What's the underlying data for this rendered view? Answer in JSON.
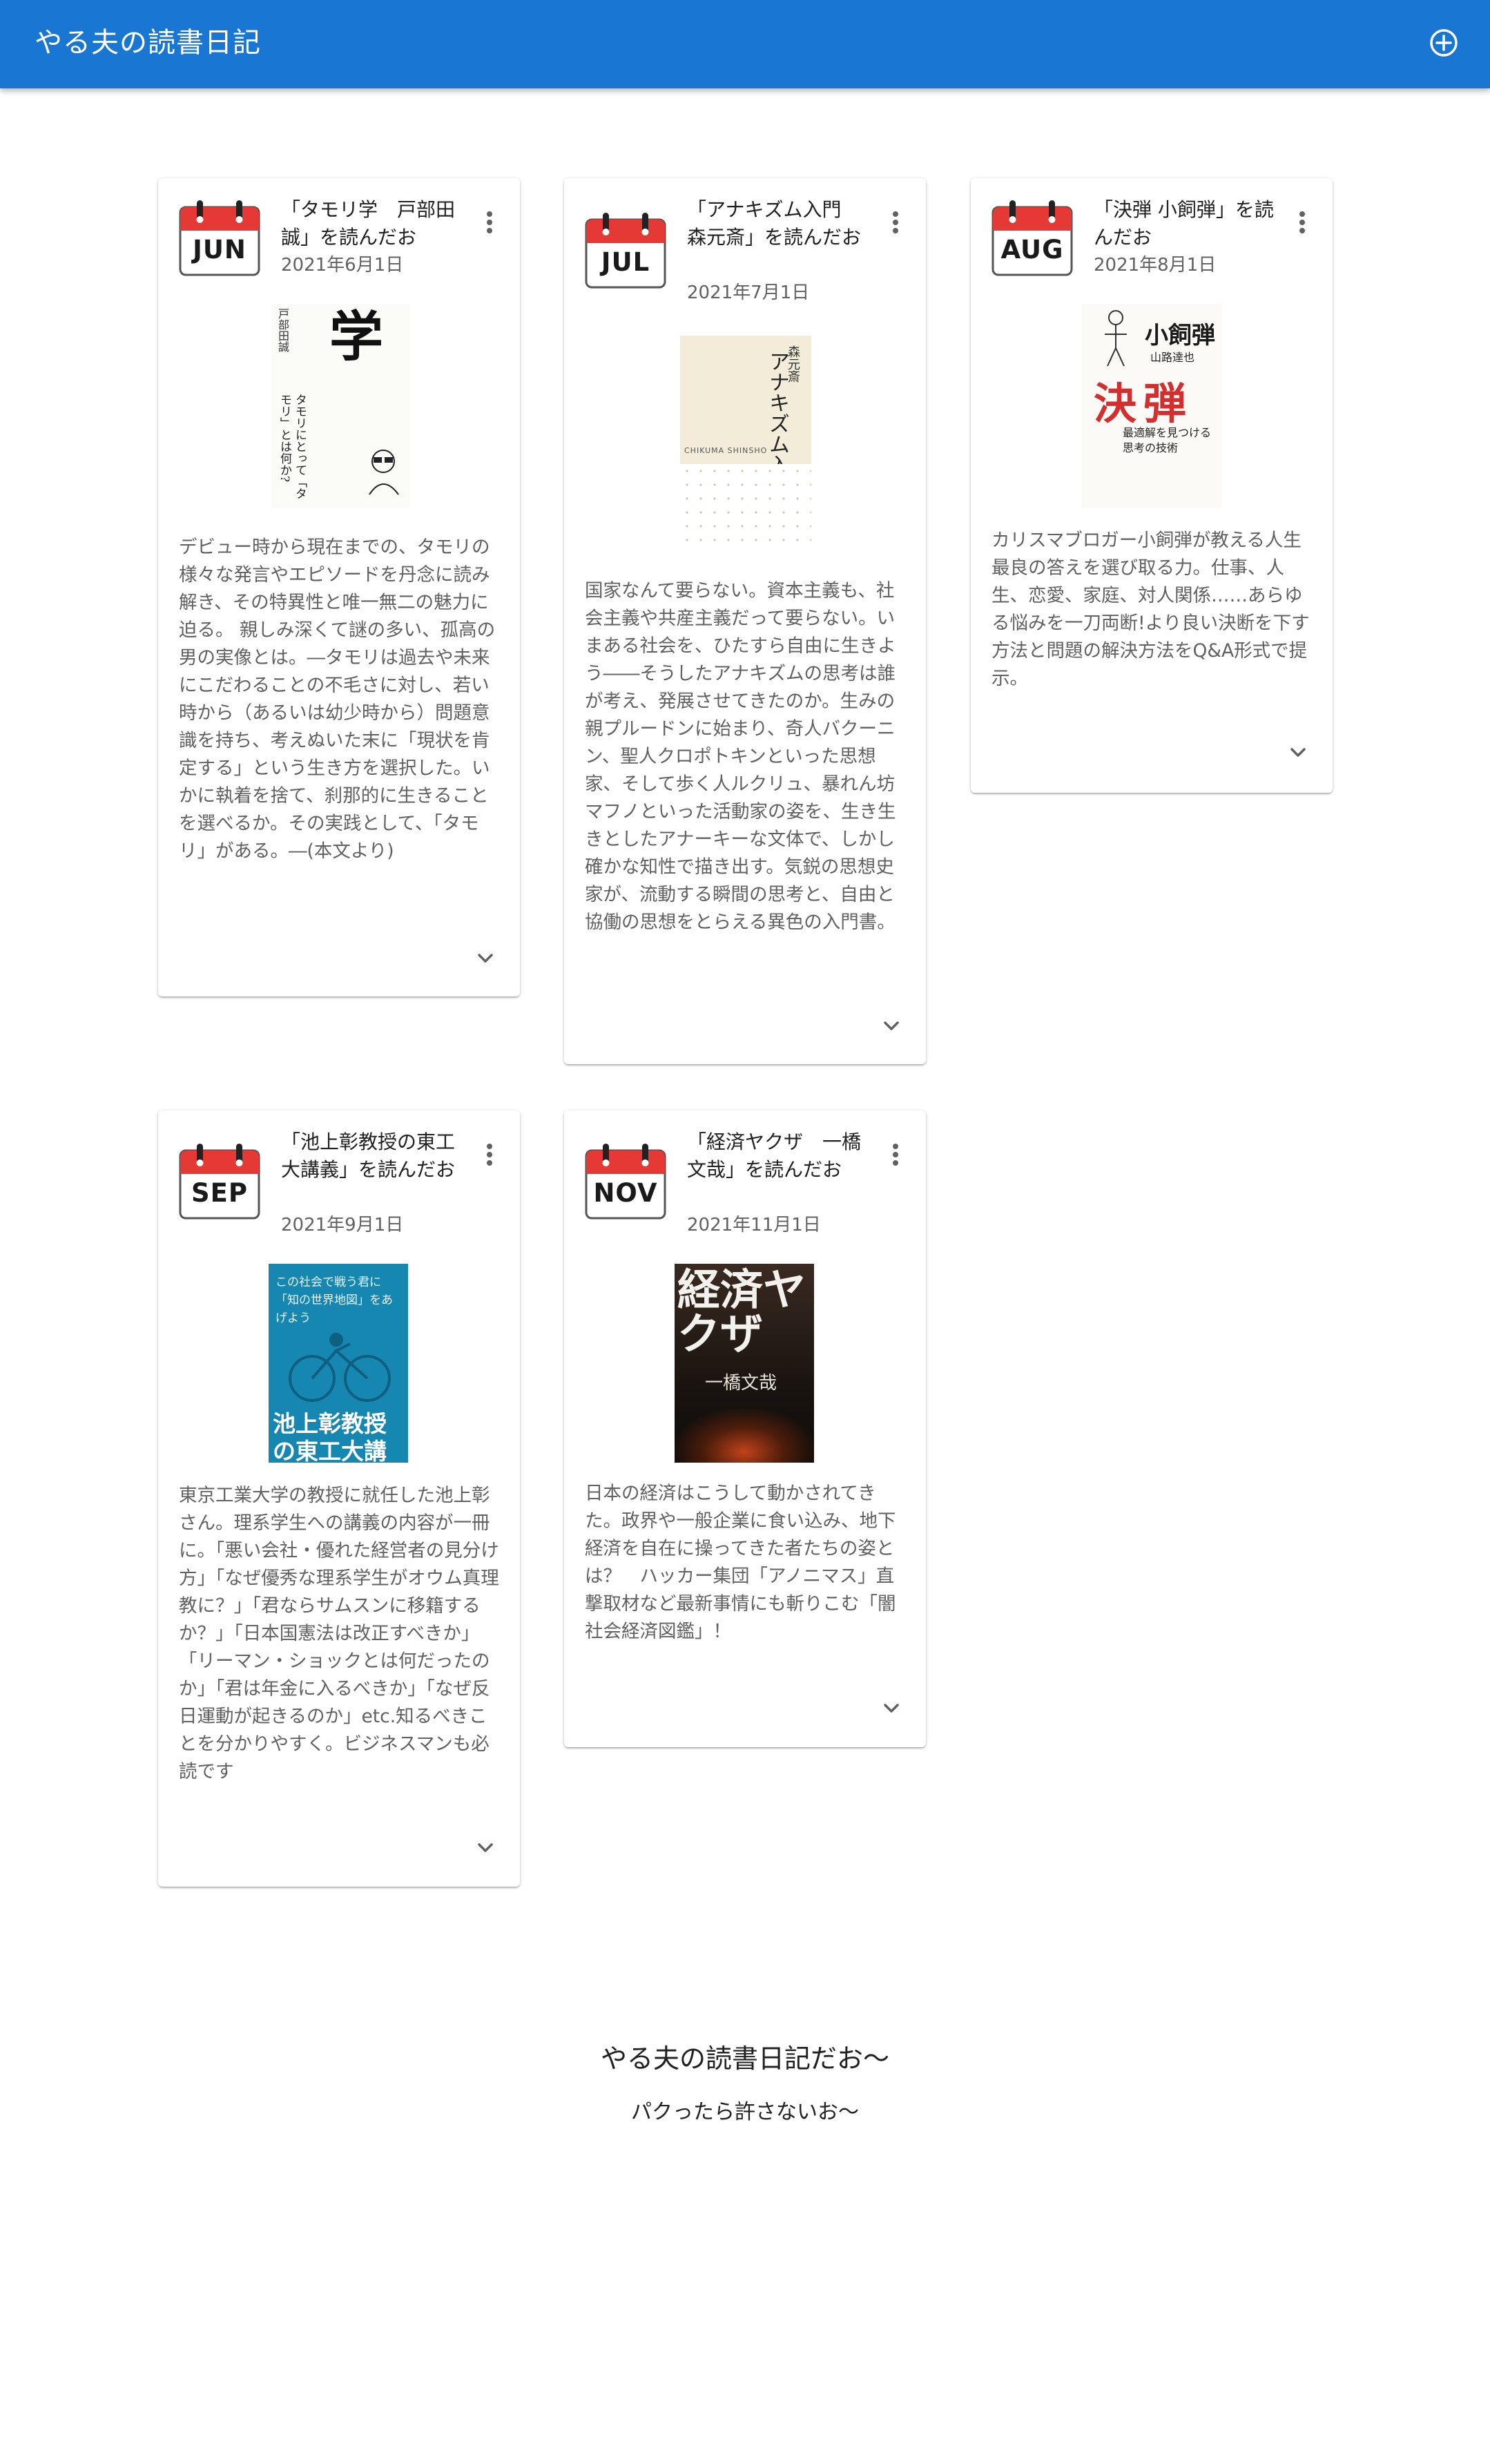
{
  "app": {
    "title": "やる夫の読書日記",
    "add_icon": "add-circle-outline-icon"
  },
  "cards": [
    {
      "month": "JUN",
      "title": "「タモリ学　戸部田誠」を読んだお",
      "date": "2021年6月1日",
      "cover": {
        "title": "タモリ学",
        "subtitle": "タモリにとって「タモリ」とは何か?",
        "author": "戸部田誠"
      },
      "description": "デビュー時から現在までの、タモリの様々な発言やエピソードを丹念に読み解き、その特異性と唯一無二の魅力に迫る。 親しみ深くて謎の多い、孤高の男の実像とは。―タモリは過去や未来にこだわることの不毛さに対し、若い時から（あるいは幼少時から）問題意識を持ち、考えぬいた末に「現状を肯定する」という生き方を選択した。いかに執着を捨て、刹那的に生きることを選べるか。その実践として、「タモリ」がある。―(本文より)"
    },
    {
      "month": "JUL",
      "title": "「アナキズム入門　森元斎」を読んだお",
      "date": "2021年7月1日",
      "cover": {
        "title": "アナキズム入門",
        "author": "森元斎",
        "publisher": "CHIKUMA SHINSHO"
      },
      "description": "国家なんて要らない。資本主義も、社会主義や共産主義だって要らない。いまある社会を、ひたすら自由に生きよう――そうしたアナキズムの思考は誰が考え、発展させてきたのか。生みの親プルードンに始まり、奇人バクーニン、聖人クロポトキンといった思想家、そして歩く人ルクリュ、暴れん坊マフノといった活動家の姿を、生き生きとしたアナーキーな文体で、しかし確かな知性で描き出す。気鋭の思想史家が、流動する瞬間の思考と、自由と協働の思想をとらえる異色の入門書。"
    },
    {
      "month": "AUG",
      "title": "「決弾 小飼弾」を読んだお",
      "date": "2021年8月1日",
      "cover": {
        "title": "決弾",
        "author": "小飼弾",
        "coauthor": "山路達也",
        "subtitle": "最適解を見つける思考の技術"
      },
      "description": "カリスマブロガー小飼弾が教える人生最良の答えを選び取る力。仕事、人生、恋愛、家庭、対人関係……あらゆる悩みを一刀両断!より良い決断を下す方法と問題の解決方法をQ&A形式で提示。"
    },
    {
      "month": "SEP",
      "title": "「池上彰教授の東工大講義」を読んだお",
      "date": "2021年9月1日",
      "cover": {
        "top": "この社会で戦う君に「知の世界地図」をあげよう",
        "title": "池上彰教授の東工大講義"
      },
      "description": "東京工業大学の教授に就任した池上彰さん。理系学生への講義の内容が一冊に。「悪い会社・優れた経営者の見分け方」「なぜ優秀な理系学生がオウム真理教に？」「君ならサムスンに移籍するか？」「日本国憲法は改正すべきか」「リーマン・ショックとは何だったのか」「君は年金に入るべきか」「なぜ反日運動が起きるのか」etc.知るべきことを分かりやすく。ビジネスマンも必読です"
    },
    {
      "month": "NOV",
      "title": "「経済ヤクザ　一橋文哉」を読んだお",
      "date": "2021年11月1日",
      "cover": {
        "title": "経済ヤクザ",
        "author": "一橋文哉"
      },
      "description": "日本の経済はこうして動かされてきた。政界や一般企業に食い込み、地下経済を自在に操ってきた者たちの姿とは？　ハッカー集団「アノニマス」直撃取材など最新事情にも斬りこむ「闇社会経済図鑑」！"
    }
  ],
  "footer": {
    "title": "やる夫の読書日記だお〜",
    "subtitle": "パクったら許さないお〜"
  },
  "icons": {
    "calendar": "calendar-icon",
    "more": "more-vert-icon",
    "expand": "chevron-down-icon"
  }
}
